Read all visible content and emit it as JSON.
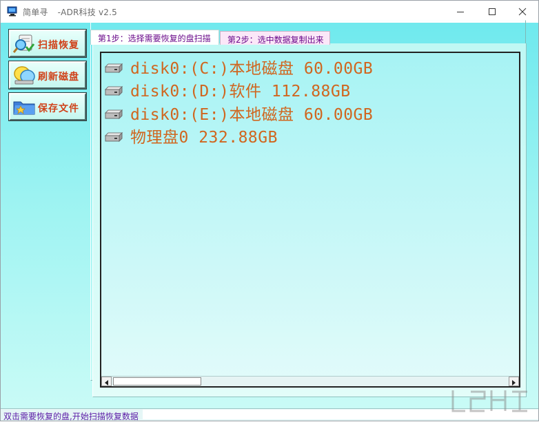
{
  "window": {
    "title_app": "简单寻",
    "title_company": " -ADR科技 v2.5",
    "minimize_icon": "minimize-icon",
    "maximize_icon": "maximize-icon",
    "close_icon": "close-icon"
  },
  "sidebar": {
    "buttons": [
      {
        "label": "扫描恢复",
        "icon": "magnifier-icon"
      },
      {
        "label": "刷新磁盘",
        "icon": "refresh-disk-icon"
      },
      {
        "label": "保存文件",
        "icon": "save-file-icon"
      }
    ]
  },
  "tabs": [
    {
      "label": "第1步：选择需要恢复的盘扫描"
    },
    {
      "label": "第2步：选中数据复制出来"
    }
  ],
  "disk_list": [
    {
      "label": "disk0:(C:)本地磁盘 60.00GB"
    },
    {
      "label": "disk0:(D:)软件 112.88GB"
    },
    {
      "label": "disk0:(E:)本地磁盘 60.00GB"
    },
    {
      "label": "物理盘0 232.88GB"
    }
  ],
  "status": {
    "text": "双击需要恢复的盘,开始扫描恢复数据"
  },
  "colors": {
    "accent_text": "#d0661f",
    "tab_text": "#6a0a8a",
    "status_text": "#5a1aa6"
  }
}
